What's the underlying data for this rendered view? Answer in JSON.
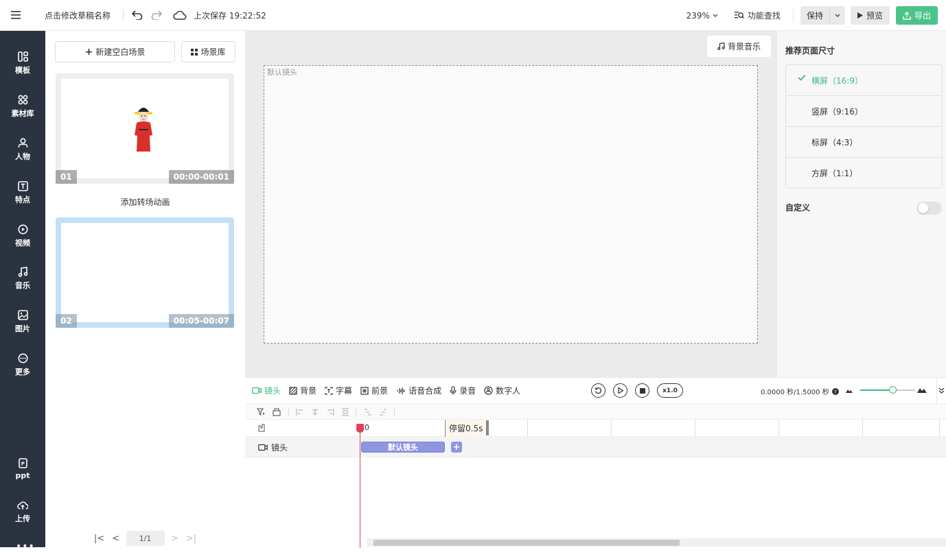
{
  "header": {
    "draft_title": "点击修改草稿名称",
    "saved_text": "上次保存 19:22:52",
    "zoom": "239%",
    "find_label": "功能查找",
    "keep_label": "保持",
    "preview_label": "预览",
    "export_label": "导出"
  },
  "sidebar": {
    "items": [
      {
        "label": "模板",
        "icon": "template-icon"
      },
      {
        "label": "素材库",
        "icon": "material-icon"
      },
      {
        "label": "人物",
        "icon": "person-icon"
      },
      {
        "label": "特点",
        "icon": "text-icon"
      },
      {
        "label": "视频",
        "icon": "video-icon"
      },
      {
        "label": "音乐",
        "icon": "music-icon"
      },
      {
        "label": "图片",
        "icon": "image-icon"
      },
      {
        "label": "更多",
        "icon": "more-icon"
      }
    ],
    "bottom": [
      {
        "label": "ppt",
        "icon": "ppt-icon"
      },
      {
        "label": "上传",
        "icon": "upload-icon"
      }
    ]
  },
  "scenes": {
    "new_blank": "新建空白场景",
    "library": "场景库",
    "transition": "添加转场动画",
    "cards": [
      {
        "num": "01",
        "duration": "00:00-00:01"
      },
      {
        "num": "02",
        "duration": "00:05-00:07"
      }
    ],
    "page": "1/1"
  },
  "canvas": {
    "bgm_label": "背景音乐",
    "shot_label": "默认镜头"
  },
  "right_panel": {
    "title": "推荐页面尺寸",
    "ratios": [
      "横屏（16:9）",
      "竖屏（9:16）",
      "标屏（4:3）",
      "方屏（1:1）"
    ],
    "active_index": 0,
    "custom_label": "自定义",
    "custom_enabled": false
  },
  "timeline": {
    "tabs": [
      "镜头",
      "背景",
      "字幕",
      "前景",
      "语音合成",
      "录音",
      "数字人"
    ],
    "speed": "x1.0",
    "time": "0.0000 秒/1.5000 秒",
    "zoom_level": 0.6,
    "ruler_zero": "0",
    "stay_label": "停留0.5s",
    "track_label": "镜头",
    "clip_label": "默认镜头",
    "accent": "#3dbb7e",
    "playhead_color": "#e0415a"
  }
}
